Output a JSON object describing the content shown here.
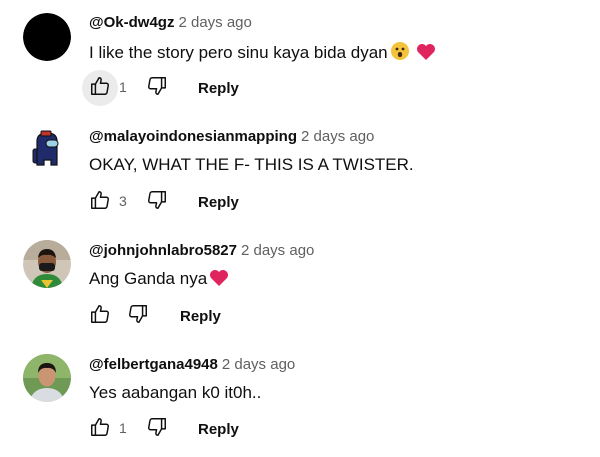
{
  "comments": [
    {
      "handle": "@Ok-dw4gz",
      "time": "2 days ago",
      "text": "I like the story pero sinu kaya bida dyan",
      "emojis": [
        "surprised-face-emoji",
        "red-heart-emoji"
      ],
      "likes": "1",
      "reply_label": "Reply",
      "avatar": "black-circle-avatar"
    },
    {
      "handle": "@malayoindonesianmapping",
      "time": "2 days ago",
      "text": "OKAY, WHAT THE F- THIS IS A TWISTER.",
      "likes": "3",
      "reply_label": "Reply",
      "avatar": "crewmate-avatar"
    },
    {
      "handle": "@johnjohnlabro5827",
      "time": "2 days ago",
      "text": "Ang Ganda nya",
      "emojis": [
        "red-heart-emoji"
      ],
      "likes": "",
      "reply_label": "Reply",
      "avatar": "photo-avatar-masked-boy"
    },
    {
      "handle": "@felbertgana4948",
      "time": "2 days ago",
      "text": "Yes aabangan k0 it0h..",
      "likes": "1",
      "reply_label": "Reply",
      "avatar": "photo-avatar-man"
    }
  ],
  "colors": {
    "text": "#0f0f0f",
    "secondary": "#606060",
    "pressed_bg": "#ebebeb",
    "heart": "#e0245e"
  }
}
